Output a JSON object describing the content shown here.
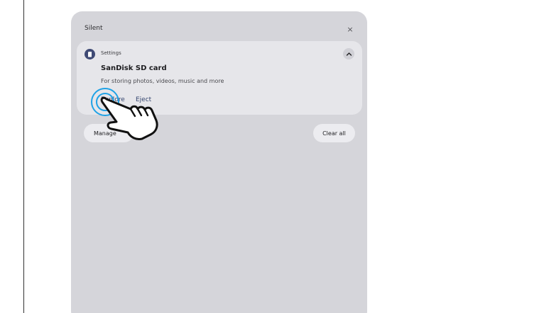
{
  "notification_shade": {
    "section_title": "Silent",
    "close_glyph": "×",
    "notification": {
      "app_icon": "sd-card-icon",
      "app_name": "Settings",
      "expand_icon": "chevron-up-icon",
      "title": "SanDisk SD card",
      "body": "For storing photos, videos, music and more",
      "actions": [
        "Explore",
        "Eject"
      ]
    },
    "manage_label": "Manage",
    "clear_all_label": "Clear all"
  },
  "overlay": {
    "pointer_icon": "hand-pointer-icon",
    "tap_indicator_color": "#1fa2e6"
  },
  "colors": {
    "shade_background": "#d5d5da",
    "card_background": "#e6e6ea",
    "accent_text": "#34456e",
    "app_icon_background": "#3f4a75"
  }
}
